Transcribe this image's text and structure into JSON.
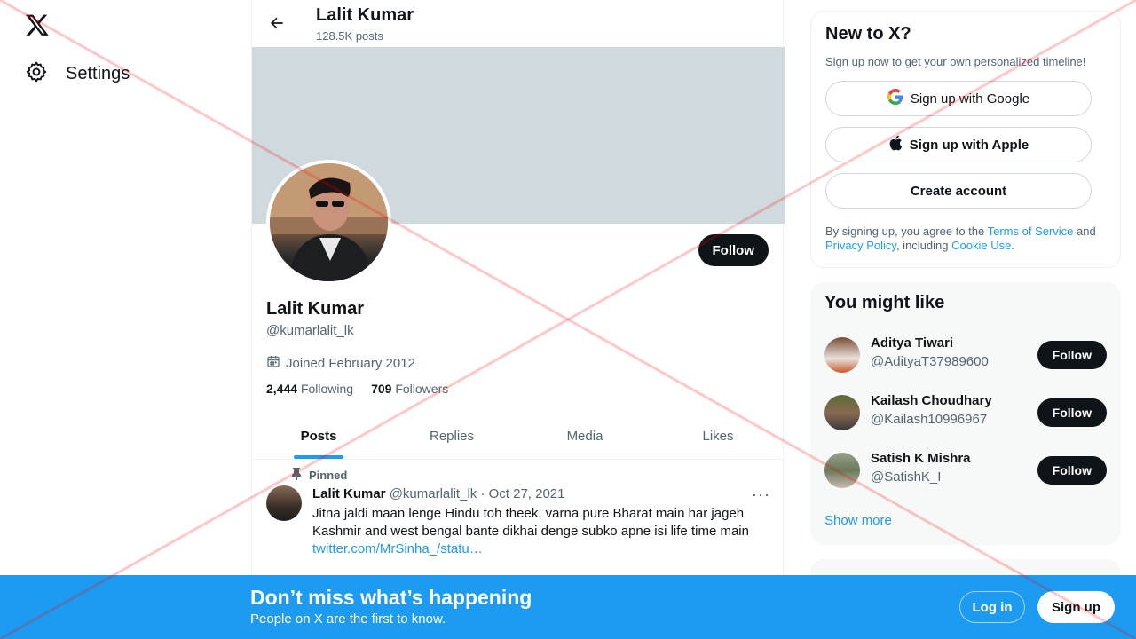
{
  "nav": {
    "settings_label": "Settings"
  },
  "header": {
    "name": "Lalit Kumar",
    "posts_count": "128.5K posts"
  },
  "profile": {
    "name": "Lalit Kumar",
    "handle": "@kumarlalit_lk",
    "joined": "Joined February 2012",
    "following_count": "2,444",
    "following_label": "Following",
    "followers_count": "709",
    "followers_label": "Followers",
    "follow_label": "Follow"
  },
  "tabs": [
    {
      "label": "Posts",
      "active": true
    },
    {
      "label": "Replies"
    },
    {
      "label": "Media"
    },
    {
      "label": "Likes"
    }
  ],
  "post": {
    "pinned_label": "Pinned",
    "author": "Lalit Kumar",
    "meta": "@kumarlalit_lk · Oct 27, 2021",
    "line1": "Jitna jaldi maan lenge Hindu toh theek, varna pure Bharat main har jageh",
    "line2": "Kashmir and west bengal bante dikhai denge subko apne isi life time main",
    "link": "twitter.com/MrSinha_/statu…",
    "more": "···"
  },
  "signup_card": {
    "title": "New to X?",
    "subtitle": "Sign up now to get your own personalized timeline!",
    "google_label": "Sign up with Google",
    "apple_label": "Sign up with Apple",
    "create_label": "Create account",
    "terms_prefix": "By signing up, you agree to the ",
    "terms_link": "Terms of Service",
    "terms_and": " and ",
    "privacy_link": "Privacy Policy",
    "terms_including": ", including ",
    "cookie_link": "Cookie Use",
    "terms_end": "."
  },
  "suggestions": {
    "title": "You might like",
    "items": [
      {
        "name": "Aditya Tiwari",
        "handle": "@AdityaT37989600",
        "follow": "Follow"
      },
      {
        "name": "Kailash Choudhary",
        "handle": "@Kailash10996967",
        "follow": "Follow"
      },
      {
        "name": "Satish K Mishra",
        "handle": "@SatishK_I",
        "follow": "Follow"
      }
    ],
    "show_more": "Show more"
  },
  "bottom_bar": {
    "title": "Don’t miss what’s happening",
    "subtitle": "People on X are the first to know.",
    "login_label": "Log in",
    "signup_label": "Sign up"
  },
  "colors": {
    "accent": "#1d9bf0",
    "text": "#0f1419",
    "muted": "#536471",
    "banner": "#cfd9de",
    "overlay": "#ff0000"
  }
}
